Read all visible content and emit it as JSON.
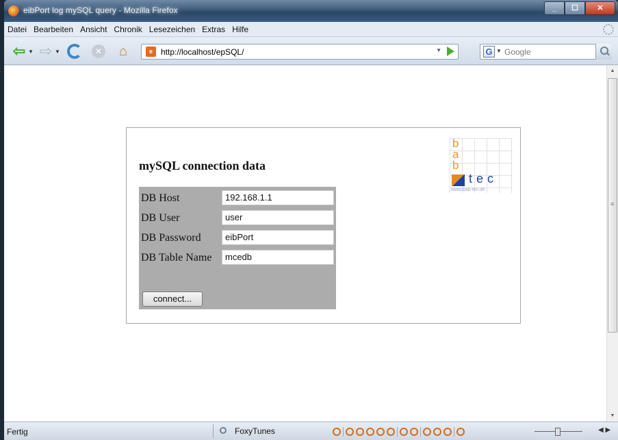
{
  "window": {
    "title": "eibPort log mySQL query - Mozilla Firefox"
  },
  "menu": [
    "Datei",
    "Bearbeiten",
    "Ansicht",
    "Chronik",
    "Lesezeichen",
    "Extras",
    "Hilfe"
  ],
  "nav": {
    "url": "http://localhost/epSQL/",
    "search_placeholder": "Google"
  },
  "page": {
    "heading": "mySQL connection data",
    "logo": {
      "b1": "b",
      "a": "a",
      "b2": "b",
      "tec": "tec",
      "site": "www.bab-tec.de"
    },
    "fields": [
      {
        "label": "DB Host",
        "value": "192.168.1.1"
      },
      {
        "label": "DB User",
        "value": "user"
      },
      {
        "label": "DB Password",
        "value": "eibPort"
      },
      {
        "label": "DB Table Name",
        "value": "mcedb"
      }
    ],
    "connect_label": "connect..."
  },
  "statusbar": {
    "status": "Fertig",
    "addon": "FoxyTunes"
  },
  "colors": {
    "accent_orange": "#e59a2e",
    "logo_blue": "#1f3fa4",
    "form_bg": "#acacac"
  }
}
